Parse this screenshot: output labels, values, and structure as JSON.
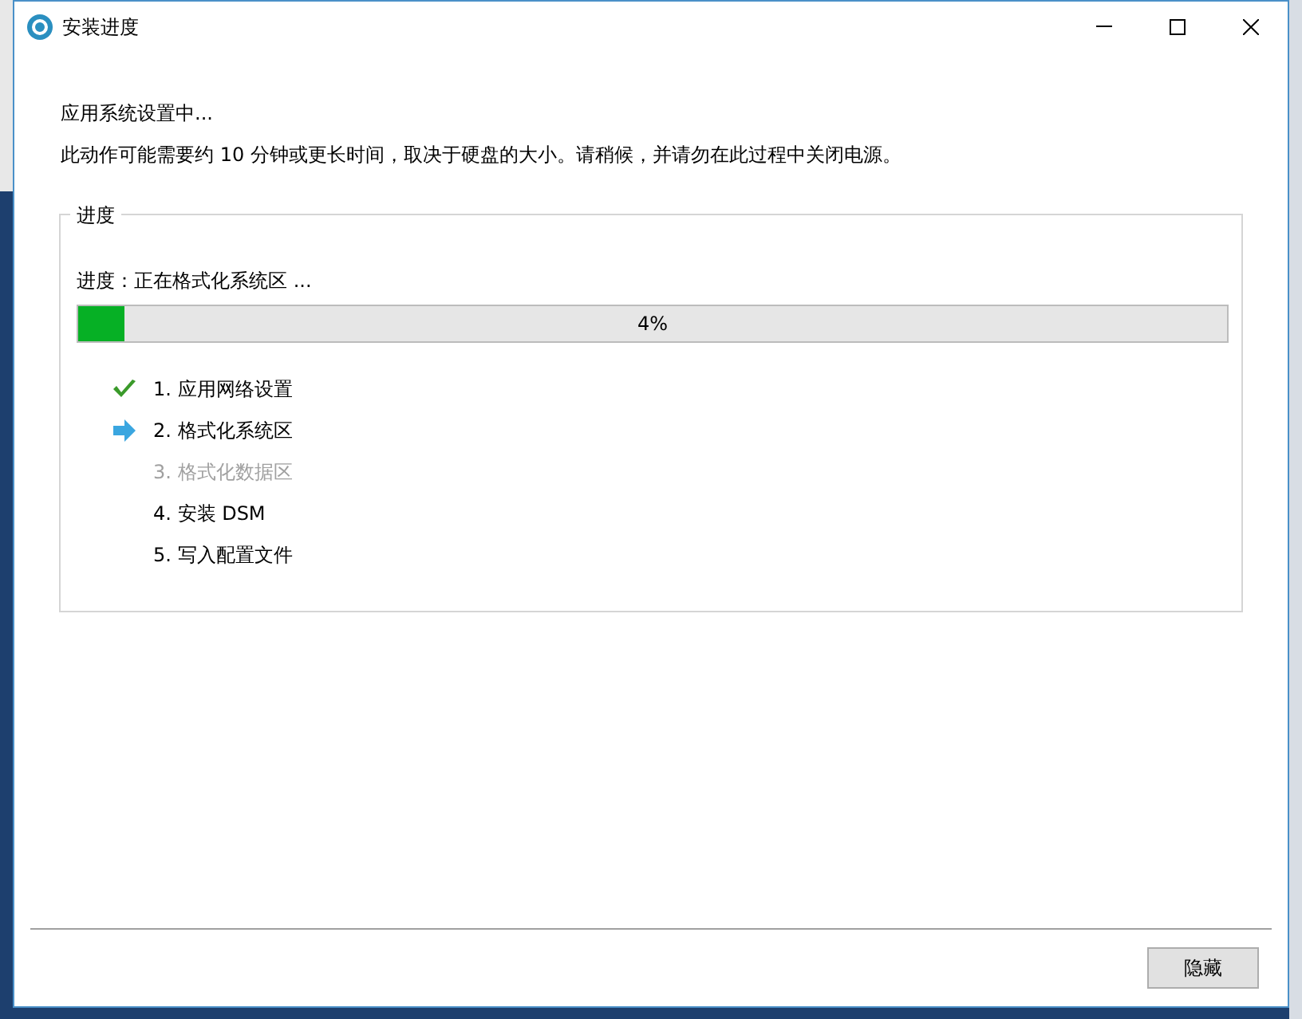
{
  "window": {
    "title": "安装进度"
  },
  "heading": "应用系统设置中...",
  "description": "此动作可能需要约 10 分钟或更长时间，取决于硬盘的大小。请稍候，并请勿在此过程中关闭电源。",
  "group": {
    "title": "进度",
    "status": "进度：正在格式化系统区 ...",
    "progress": {
      "level": 0.04,
      "reading": "4%"
    },
    "steps": [
      {
        "label": "1. 应用网络设置",
        "kind": "done",
        "disabled": false
      },
      {
        "label": "2. 格式化系统区",
        "kind": "current",
        "disabled": false
      },
      {
        "label": "3. 格式化数据区",
        "kind": "pending",
        "disabled": true
      },
      {
        "label": "4. 安装 DSM",
        "kind": "pending",
        "disabled": false
      },
      {
        "label": "5. 写入配置文件",
        "kind": "pending",
        "disabled": false
      }
    ]
  },
  "buttons": [
    "隐藏"
  ]
}
